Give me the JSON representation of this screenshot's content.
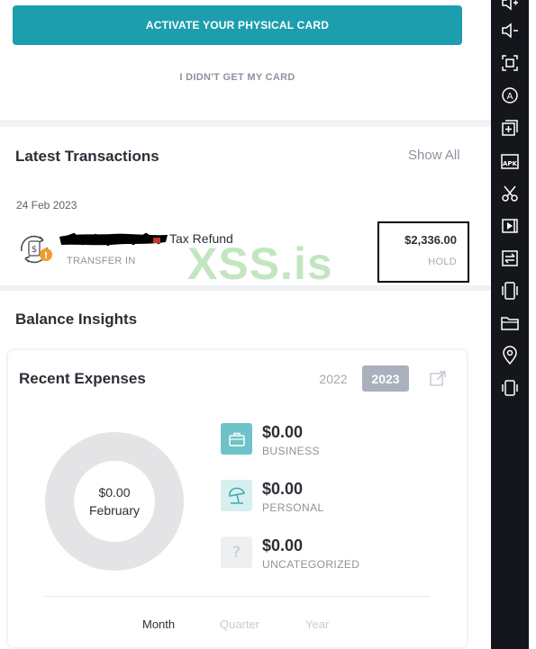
{
  "card": {
    "activate_label": "ACTIVATE YOUR PHYSICAL CARD",
    "no_card_label": "I DIDN'T GET MY CARD"
  },
  "transactions": {
    "title": "Latest Transactions",
    "show_all": "Show All",
    "date": "24 Feb 2023",
    "items": [
      {
        "name": "Tax Refund",
        "type": "TRANSFER IN",
        "amount": "$2,336.00",
        "status": "HOLD",
        "icon": "transfer-in-icon"
      }
    ]
  },
  "watermark": "XSS.is",
  "insights": {
    "title": "Balance Insights",
    "expenses": {
      "title": "Recent Expenses",
      "years": [
        "2022",
        "2023"
      ],
      "selected_year": "2023",
      "donut_amount": "$0.00",
      "donut_month": "February",
      "categories": [
        {
          "value": "$0.00",
          "label": "BUSINESS",
          "icon": "briefcase-icon",
          "color": "#6ec3c8"
        },
        {
          "value": "$0.00",
          "label": "PERSONAL",
          "icon": "beach-umbrella-icon",
          "color": "#d8eff0"
        },
        {
          "value": "$0.00",
          "label": "UNCATEGORIZED",
          "icon": "question-icon",
          "color": "#eeeff1"
        }
      ],
      "periods": [
        "Month",
        "Quarter",
        "Year"
      ],
      "selected_period": "Month"
    }
  },
  "toolbar": {
    "tools": [
      "volume-up-icon",
      "volume-down-icon",
      "screenshot-icon",
      "rotate-icon",
      "add-window-icon",
      "apk-icon",
      "cut-icon",
      "video-record-icon",
      "import-icon",
      "shake-icon",
      "folder-icon",
      "location-icon",
      "vibrate-icon"
    ],
    "apk_label": "APK"
  },
  "colors": {
    "accent": "#1d9eae",
    "toolbar_bg": "#14161c",
    "donut": "#e4e4e6"
  }
}
